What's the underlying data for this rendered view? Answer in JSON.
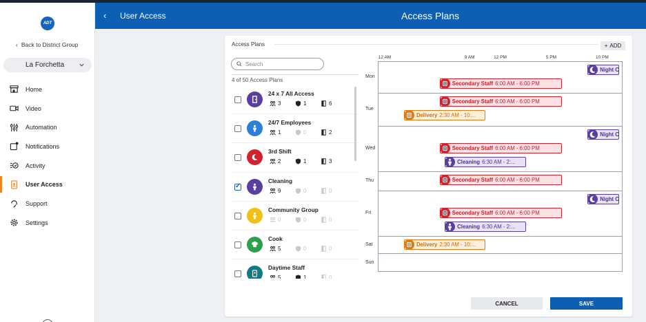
{
  "sidebar": {
    "logo_text": "ADT",
    "back_label": "Back to District Group",
    "site_name": "La Forchetta",
    "nav": [
      {
        "label": "Home",
        "icon": "storefront-icon"
      },
      {
        "label": "Video",
        "icon": "camera-icon"
      },
      {
        "label": "Automation",
        "icon": "sliders-icon"
      },
      {
        "label": "Notifications",
        "icon": "notification-icon"
      },
      {
        "label": "Activity",
        "icon": "activity-icon"
      },
      {
        "label": "User Access",
        "icon": "badge-icon",
        "active": true
      },
      {
        "label": "Support",
        "icon": "headset-icon"
      },
      {
        "label": "Settings",
        "icon": "gear-icon"
      }
    ]
  },
  "header": {
    "breadcrumb": "User Access",
    "title": "Access Plans"
  },
  "panel": {
    "title": "Access Plans",
    "add_label": "ADD",
    "search_placeholder": "Search",
    "count_label": "4 of 50 Access Plans"
  },
  "plans": [
    {
      "name": "24 x 7 All Access",
      "color": "#5b3f9e",
      "icon": "door-icon",
      "users": "3",
      "locks": "1",
      "doors": "6",
      "checked": false,
      "muted": [
        false,
        false,
        false
      ]
    },
    {
      "name": "24/7 Employees",
      "color": "#2a7fd6",
      "icon": "person-icon",
      "users": "1",
      "locks": "0",
      "doors": "2",
      "checked": false,
      "muted": [
        false,
        true,
        false
      ]
    },
    {
      "name": "3rd Shift",
      "color": "#d3222f",
      "icon": "moon-icon",
      "users": "2",
      "locks": "1",
      "doors": "3",
      "checked": false,
      "muted": [
        false,
        false,
        false
      ]
    },
    {
      "name": "Cleaning",
      "color": "#5b3f9e",
      "icon": "person-icon",
      "users": "9",
      "locks": "0",
      "doors": "0",
      "checked": true,
      "muted": [
        false,
        true,
        true
      ]
    },
    {
      "name": "Community Group",
      "color": "#f2c014",
      "icon": "person-icon",
      "users": "0",
      "locks": "0",
      "doors": "0",
      "checked": false,
      "muted": [
        true,
        true,
        true
      ]
    },
    {
      "name": "Cook",
      "color": "#2aa14a",
      "icon": "chef-hat-icon",
      "users": "5",
      "locks": "0",
      "doors": "0",
      "checked": false,
      "muted": [
        false,
        true,
        true
      ]
    },
    {
      "name": "Daytime Staff",
      "color": "#137c83",
      "icon": "badge-icon",
      "users": "5",
      "locks": "1",
      "doors": "0",
      "checked": false,
      "muted": [
        false,
        false,
        true
      ]
    }
  ],
  "schedule": {
    "hours": [
      {
        "label": "12 AM",
        "h": 0
      },
      {
        "label": "9 AM",
        "h": 9
      },
      {
        "label": "12 PM",
        "h": 12
      },
      {
        "label": "5 PM",
        "h": 17
      },
      {
        "label": "10 PM",
        "h": 22
      }
    ],
    "days": [
      "Mon",
      "Tue",
      "Wed",
      "Thu",
      "Fri",
      "Sat",
      "Sun"
    ],
    "events": [
      {
        "day": "Mon",
        "name": "Night Clea...",
        "time": "",
        "color": "purple",
        "icon": "moon-icon",
        "start": 20.5,
        "end": 23.8
      },
      {
        "day": "Mon",
        "name": "Secondary Staff",
        "time": "6:00 AM - 6:00 PM",
        "color": "red",
        "icon": "list-icon",
        "start": 6,
        "end": 18
      },
      {
        "day": "Tue",
        "name": "Secondary Staff",
        "time": "6:00 AM - 6:00 PM",
        "color": "red",
        "icon": "list-icon",
        "start": 6,
        "end": 18
      },
      {
        "day": "Tue",
        "name": "Delivery",
        "time": "2:30 AM - 10:...",
        "color": "orange",
        "icon": "list-icon",
        "start": 2.5,
        "end": 10.5
      },
      {
        "day": "Wed",
        "name": "Night Clea...",
        "time": "",
        "color": "purple",
        "icon": "moon-icon",
        "start": 20.5,
        "end": 23.8
      },
      {
        "day": "Wed",
        "name": "Secondary Staff",
        "time": "6:00 AM - 6:00 PM",
        "color": "red",
        "icon": "list-icon",
        "start": 6,
        "end": 18
      },
      {
        "day": "Wed",
        "name": "Cleaning",
        "time": "6:30 AM - 2:...",
        "color": "purple",
        "icon": "person-icon",
        "start": 6.5,
        "end": 14.5
      },
      {
        "day": "Thu",
        "name": "Secondary Staff",
        "time": "6:00 AM - 6:00 PM",
        "color": "red",
        "icon": "list-icon",
        "start": 6,
        "end": 18
      },
      {
        "day": "Fri",
        "name": "Night Clea...",
        "time": "",
        "color": "purple",
        "icon": "moon-icon",
        "start": 20.5,
        "end": 23.8
      },
      {
        "day": "Fri",
        "name": "Secondary Staff",
        "time": "6:00 AM - 6:00 PM",
        "color": "red",
        "icon": "list-icon",
        "start": 6,
        "end": 18
      },
      {
        "day": "Fri",
        "name": "Cleaning",
        "time": "6:30 AM - 2:...",
        "color": "purple",
        "icon": "person-icon",
        "start": 6.5,
        "end": 14.5
      },
      {
        "day": "Sat",
        "name": "Delivery",
        "time": "2:30 AM - 10:...",
        "color": "orange",
        "icon": "list-icon",
        "start": 2.5,
        "end": 10.5
      }
    ]
  },
  "actions": {
    "cancel_label": "CANCEL",
    "save_label": "SAVE"
  },
  "colors": {
    "brand_blue": "#0d5fb3",
    "active_accent": "#f0841f"
  }
}
